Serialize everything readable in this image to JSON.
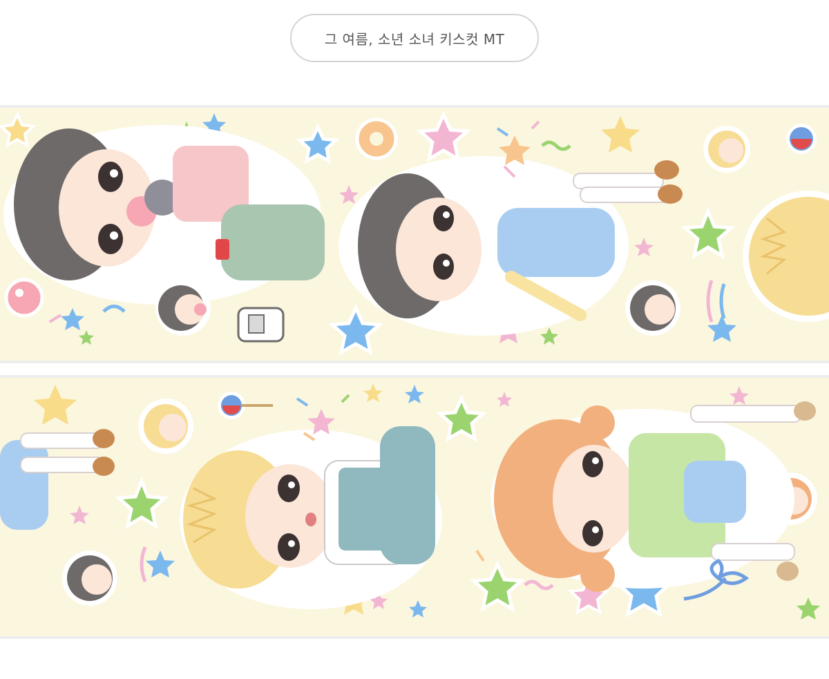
{
  "product": {
    "title": "그 여름, 소년 소녀 키스컷 MT"
  },
  "colors": {
    "background": "#ffffff",
    "tape_base": "#fbf6de",
    "pill_border": "#d4d4d4",
    "title_text": "#555555",
    "star_blue": "#7ab8ee",
    "star_pink": "#f2b6d3",
    "star_yellow": "#f8dc8a",
    "star_green": "#9bd36f",
    "hair_dark": "#6e6a6a",
    "hair_blonde": "#f7dc93",
    "hair_orange": "#f2b07e",
    "skin": "#fbe6d8",
    "dress_blue": "#a9cdf0",
    "shirt_pink": "#f6c6c9",
    "pants_green": "#a9c6b0",
    "cardigan_green": "#c6e6a6"
  },
  "illustration": {
    "strip_1": {
      "characters": [
        "boy-with-headphones",
        "girl-in-blue-dress",
        "blonde-boy-partial"
      ],
      "items": [
        "bubble-gum",
        "flip-phone",
        "pinwheel-candy",
        "flower-cookie",
        "confetti"
      ]
    },
    "strip_2": {
      "characters": [
        "girl-in-blue-dress-partial",
        "blonde-boy-sitting",
        "orange-haired-girl"
      ],
      "items": [
        "candy-apple",
        "ribbon-bow",
        "confetti"
      ]
    }
  }
}
